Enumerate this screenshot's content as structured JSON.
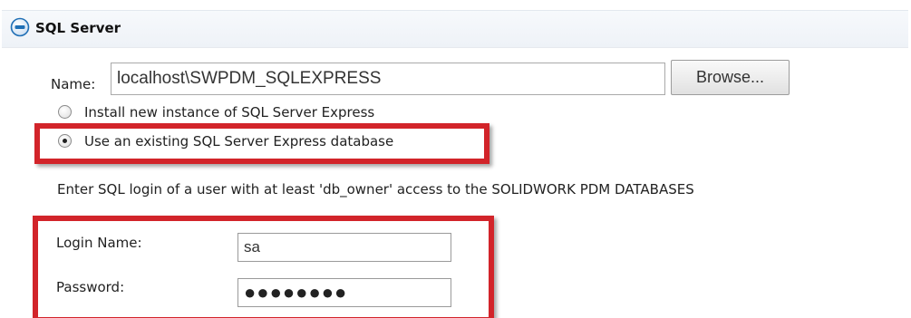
{
  "section": {
    "title": "SQL Server",
    "collapse_icon": "minus-circle-icon"
  },
  "server": {
    "name_label": "Name:",
    "name_value": "localhost\\SWPDM_SQLEXPRESS",
    "browse_label": "Browse..."
  },
  "options": [
    {
      "label": "Install new instance of SQL Server Express",
      "selected": false
    },
    {
      "label": "Use an existing SQL Server Express database",
      "selected": true
    }
  ],
  "instruction": "Enter SQL login of a user with at least 'db_owner' access to the SOLIDWORK PDM DATABASES",
  "login": {
    "login_name_label": "Login Name:",
    "login_name_value": "sa",
    "password_label": "Password:",
    "password_value": "●●●●●●●●"
  },
  "colors": {
    "highlight": "#d2242a",
    "icon_blue": "#1f6fb5"
  }
}
